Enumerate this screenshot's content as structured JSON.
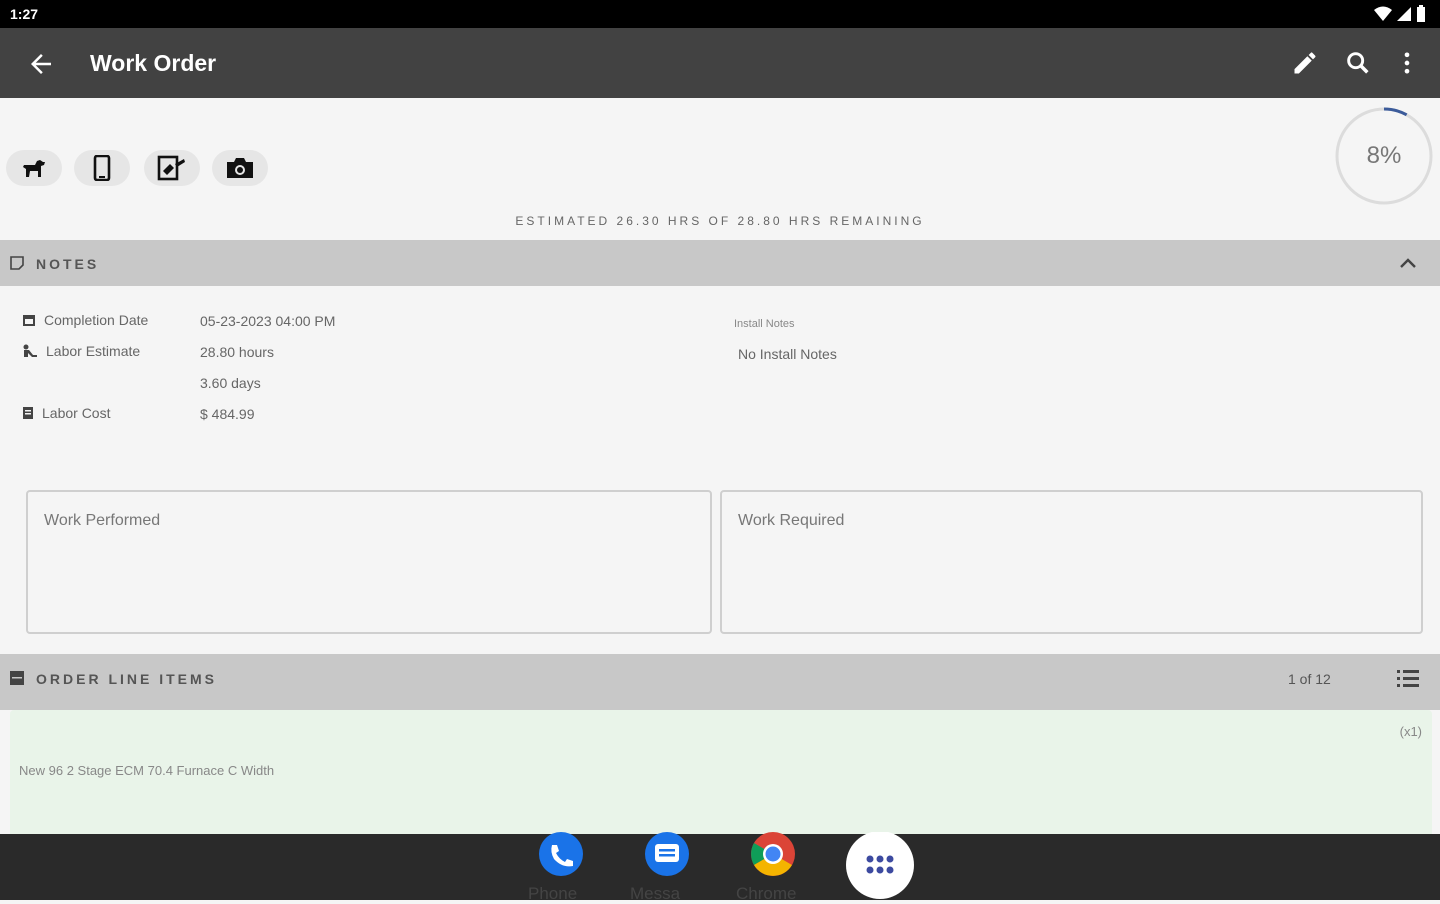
{
  "status_bar": {
    "time": "1:27"
  },
  "app_bar": {
    "title": "Work Order"
  },
  "progress": {
    "percent_label": "8%",
    "value": 0.08
  },
  "estimate_text": "ESTIMATED 26.30 HRS OF 28.80 HRS REMAINING",
  "notes": {
    "section_label": "NOTES",
    "completion_date_label": "Completion Date",
    "completion_date_value": "05-23-2023 04:00 PM",
    "labor_estimate_label": "Labor Estimate",
    "labor_hours_value": "28.80 hours",
    "labor_days_value": "3.60 days",
    "labor_cost_label": "Labor Cost",
    "labor_cost_value": "$ 484.99",
    "install_notes_label": "Install Notes",
    "install_notes_value": "No Install Notes",
    "work_performed_placeholder": "Work Performed",
    "work_required_placeholder": "Work Required"
  },
  "order_line_items": {
    "section_label": "ORDER LINE ITEMS",
    "pager": "1 of 12",
    "items": [
      {
        "description": "New 96 2 Stage ECM 70.4 Furnace C Width",
        "quantity": "(x1)"
      }
    ]
  },
  "dock": {
    "apps": [
      {
        "label": "Phone"
      },
      {
        "label": "Messa"
      },
      {
        "label": "Chrome"
      }
    ]
  },
  "colors": {
    "app_bar": "#424242",
    "section_bar": "#c8c8c8",
    "line_item_bg": "#e9f4e9",
    "progress_arc": "#3b5b9a"
  }
}
